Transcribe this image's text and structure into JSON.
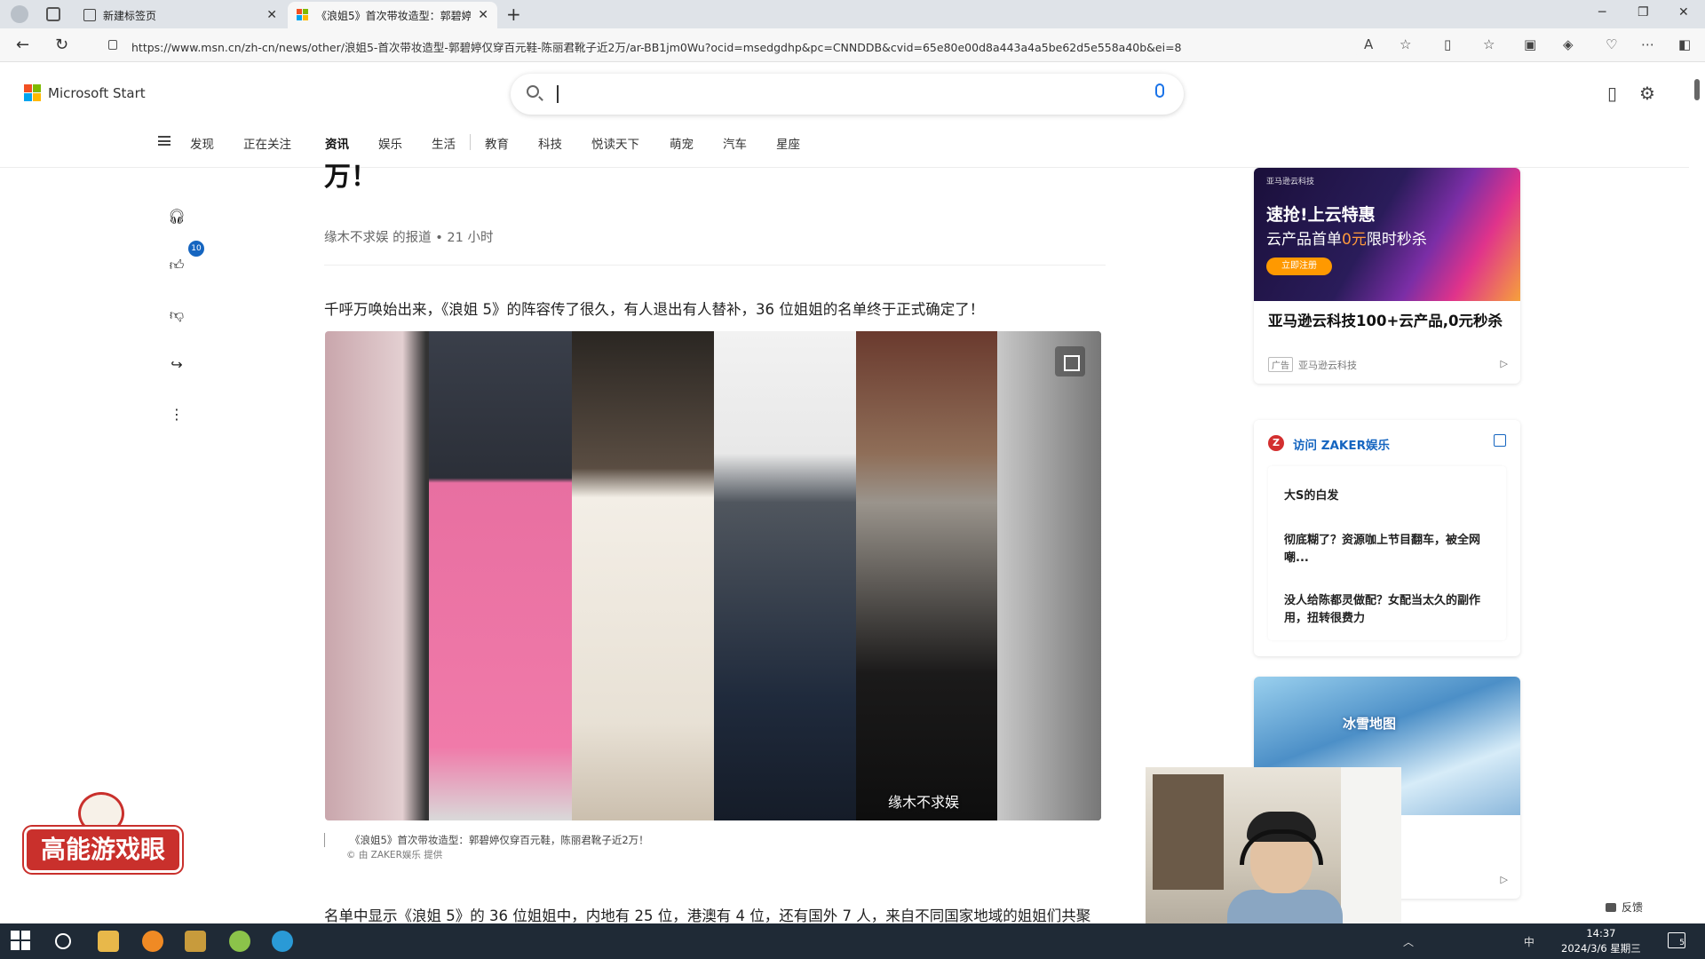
{
  "browser": {
    "tabs": [
      {
        "label": "新建标签页",
        "active": false
      },
      {
        "label": "《浪姐5》首次带妆造型：郭碧婷",
        "active": true
      }
    ],
    "url": "https://www.msn.cn/zh-cn/news/other/浪姐5-首次带妆造型-郭碧婷仅穿百元鞋-陈丽君靴子近2万/ar-BB1jm0Wu?ocid=msedgdhp&pc=CNNDDB&cvid=65e80e00d8a443a4a5be62d5e558a40b&ei=8",
    "close_glyph": "✕",
    "new_tab_glyph": "+",
    "min_glyph": "─",
    "restore_glyph": "❐",
    "win_close_glyph": "✕"
  },
  "msn": {
    "logo_text": "Microsoft Start",
    "nav": [
      "发现",
      "正在关注",
      "资讯",
      "娱乐",
      "生活",
      "教育",
      "科技",
      "悦读天下",
      "萌宠",
      "汽车",
      "星座"
    ],
    "active_nav": "资讯"
  },
  "rail": {
    "like_count": "10"
  },
  "article": {
    "title_partial": "《浪姐5》首次带妆造型：郭碧婷仅穿百元鞋，陈丽君靴子近2万！",
    "title_visible_line": "万！",
    "meta": "缘木不求娱 的报道 • 21 小时",
    "lead": "千呼万唤始出来，《浪姐 5》的阵容传了很久，有人退出有人替补，36 位姐姐的名单终于正式确定了！",
    "image_watermark": "缘木不求娱",
    "caption": "《浪姐5》首次带妆造型：郭碧婷仅穿百元鞋，陈丽君靴子近2万！",
    "credit": "© 由 ZAKER娱乐 提供",
    "body_partial": "名单中显示《浪姐 5》的 36 位姐姐中，内地有 25 位，港澳有 4 位，还有国外 7 人，来自不同国家地域的姐姐们共聚"
  },
  "ad": {
    "brand": "亚马逊云科技",
    "headline1": "速抢!上云特惠",
    "headline2_pre": "云产品首单",
    "headline2_hl": "0元",
    "headline2_post": "限时秒杀",
    "cta": "立即注册",
    "title": "亚马逊云科技100+云产品,0元秒杀",
    "tag": "广告",
    "source": "亚马逊云科技"
  },
  "zaker": {
    "header": "访问 ZAKER娱乐",
    "items": [
      "大S的白发",
      "彻底糊了？资源咖上节目翻车，被全网嘲...",
      "没人给陈都灵做配？女配当太久的副作用，扭转很费力"
    ]
  },
  "game_ad": {
    "title": "冰雪地图"
  },
  "feedback_label": "反馈",
  "overlay": {
    "logo_text": "高能游戏眼"
  },
  "taskbar": {
    "time": "14:37",
    "date": "2024/3/6 星期三",
    "ime": "中",
    "notif_count": "5"
  },
  "colors": {
    "accent_blue": "#1565c0",
    "ad_orange": "#ff9900",
    "logo_red": "#c9302c"
  }
}
